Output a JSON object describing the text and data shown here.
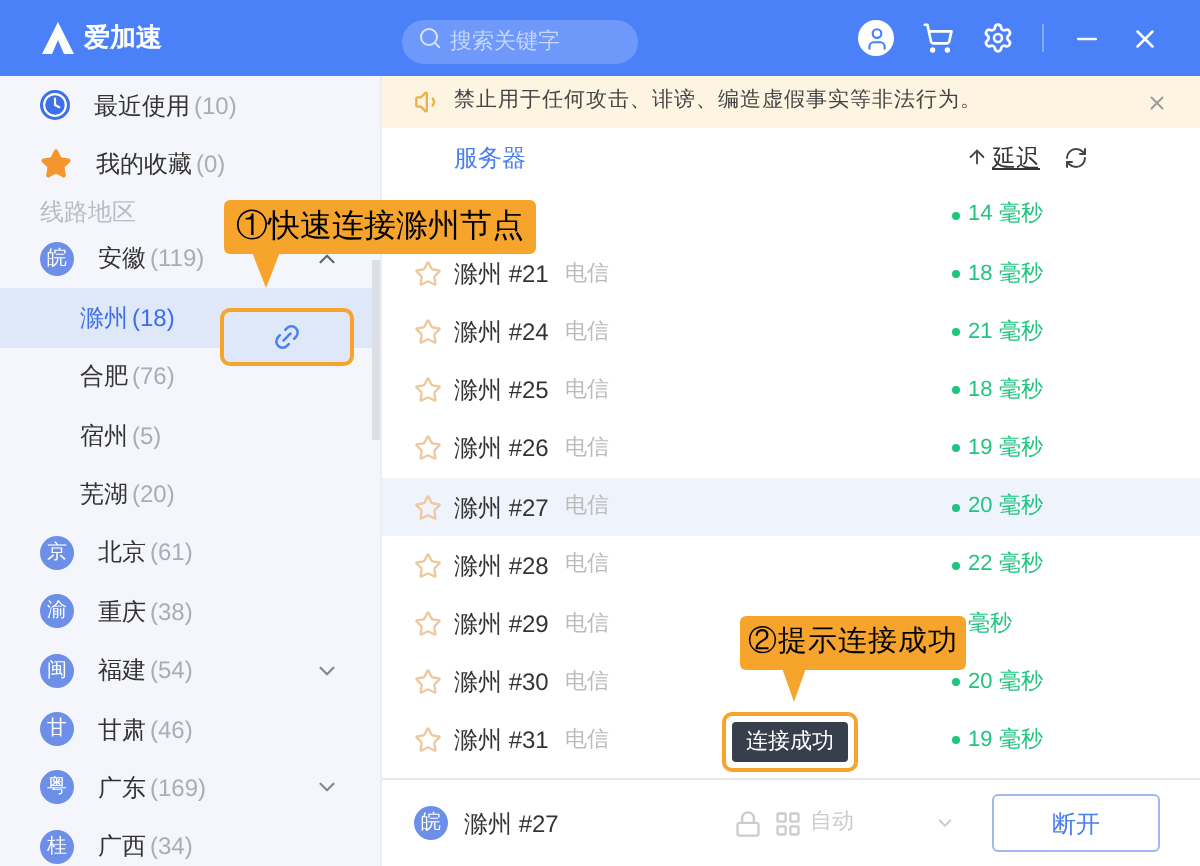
{
  "app": {
    "title": "爱加速"
  },
  "search": {
    "placeholder": "搜索关键字"
  },
  "sidebar": {
    "items": [
      {
        "kind": "recent",
        "label": "最近使用",
        "count": "(10)"
      },
      {
        "kind": "favorites",
        "label": "我的收藏",
        "count": "(0)"
      },
      {
        "kind": "heading",
        "label": "线路地区"
      },
      {
        "kind": "region",
        "badge": "皖",
        "label": "安徽",
        "count": "(119)",
        "expanded": true,
        "children": [
          {
            "label": "滁州",
            "count": "(18)",
            "selected": true
          },
          {
            "label": "合肥",
            "count": "(76)",
            "selected": false
          },
          {
            "label": "宿州",
            "count": "(5)",
            "selected": false
          },
          {
            "label": "芜湖",
            "count": "(20)",
            "selected": false
          }
        ]
      },
      {
        "kind": "region",
        "badge": "京",
        "label": "北京",
        "count": "(61)"
      },
      {
        "kind": "region",
        "badge": "渝",
        "label": "重庆",
        "count": "(38)"
      },
      {
        "kind": "region",
        "badge": "闽",
        "label": "福建",
        "count": "(54)",
        "expanded": false
      },
      {
        "kind": "region",
        "badge": "甘",
        "label": "甘肃",
        "count": "(46)"
      },
      {
        "kind": "region",
        "badge": "粤",
        "label": "广东",
        "count": "(169)",
        "expanded": false
      },
      {
        "kind": "region",
        "badge": "桂",
        "label": "广西",
        "count": "(34)"
      }
    ]
  },
  "notice": {
    "text": "禁止用于任何攻击、诽谤、编造虚假事实等非法行为。"
  },
  "server_list": {
    "columns": {
      "server": "服务器",
      "latency": "延迟"
    },
    "rows": [
      {
        "kind": "covered",
        "latency": "14 毫秒",
        "selected": false
      },
      {
        "kind": "server",
        "name": "滁州 #21",
        "carrier": "电信",
        "latency": "18 毫秒",
        "selected": false
      },
      {
        "kind": "server",
        "name": "滁州 #24",
        "carrier": "电信",
        "latency": "21 毫秒",
        "selected": false
      },
      {
        "kind": "server",
        "name": "滁州 #25",
        "carrier": "电信",
        "latency": "18 毫秒",
        "selected": false
      },
      {
        "kind": "server",
        "name": "滁州 #26",
        "carrier": "电信",
        "latency": "19 毫秒",
        "selected": false
      },
      {
        "kind": "server",
        "name": "滁州 #27",
        "carrier": "电信",
        "latency": "20 毫秒",
        "selected": true
      },
      {
        "kind": "server",
        "name": "滁州 #28",
        "carrier": "电信",
        "latency": "22 毫秒",
        "selected": false
      },
      {
        "kind": "server",
        "name": "滁州 #29",
        "carrier": "电信",
        "latency": "毫秒",
        "selected": false
      },
      {
        "kind": "server",
        "name": "滁州 #30",
        "carrier": "电信",
        "latency": "20 毫秒",
        "selected": false
      },
      {
        "kind": "server",
        "name": "滁州 #31",
        "carrier": "电信",
        "latency": "19 毫秒",
        "selected": false
      }
    ]
  },
  "footer": {
    "badge": "皖",
    "server": "滁州 #27",
    "mode": "自动",
    "button": "断开"
  },
  "callouts": [
    {
      "text": "①快速连接滁州节点"
    },
    {
      "text": "②提示连接成功"
    }
  ],
  "toast": {
    "text": "连接成功"
  }
}
